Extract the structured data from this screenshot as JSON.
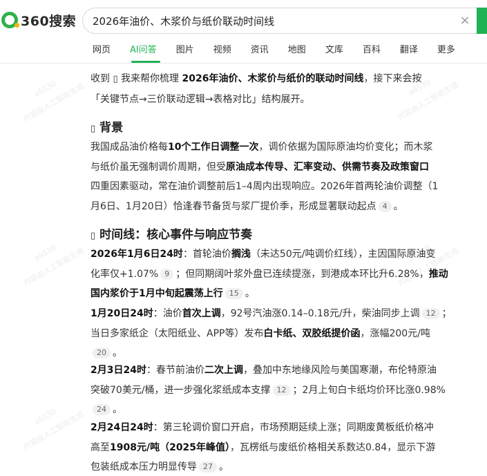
{
  "header": {
    "logo_text": "360搜索",
    "search_value": "2026年油价、木浆价与纸价联动时间线",
    "clear_symbol": "×"
  },
  "tabs": [
    "网页",
    "AI问答",
    "图片",
    "视频",
    "资讯",
    "地图",
    "文库",
    "百科",
    "翻译",
    "更多"
  ],
  "active_tab": "AI问答",
  "answer": {
    "intro_line1_a": "收到 ",
    "intro_icon": "▯",
    "intro_line1_b": " 我来帮你梳理 ",
    "intro_line1_bold": "2026年油价、木浆价与纸价的联动时间线",
    "intro_line1_c": "，接下来会按",
    "intro_line2": "「关键节点→三价联动逻辑→表格对比」结构展开。",
    "section1_icon": "▯",
    "section1_title": "背景",
    "bg_l1_a": "我国成品油价格每",
    "bg_l1_bold": "10个工作日调整一次",
    "bg_l1_b": "，调价依据为国际原油均价变化；而木浆",
    "bg_l2_a": "与纸价虽无强制调价周期，但受",
    "bg_l2_bold": "原油成本传导、汇率变动、供需节奏及政策窗口",
    "bg_l3": "四重因素驱动，常在油价调整前后1–4周内出现响应。2026年首两轮油价调整（1",
    "bg_l4": "月6日、1月20日）恰逢春节备货与浆厂提价季，形成显著联动起点",
    "bg_cite": "4",
    "bg_l4_end": "。",
    "section2_icon": "▯",
    "section2_title": "时间线：核心事件与响应节奏",
    "t1_l1_date": "2026年1月6日24时",
    "t1_l1_a": "：首轮油价",
    "t1_l1_bold": "搁浅",
    "t1_l1_b": "（未达50元/吨调价红线），主因国际原油变",
    "t1_l2_a": "化率仅+1.07%",
    "t1_cite1": "9",
    "t1_l2_b": "；但同期阔叶浆外盘已连续提涨，到港成本环比升6.28%，",
    "t1_l2_bold": "推动",
    "t1_l3_bold": "国内浆价于1月中旬起震荡上行",
    "t1_cite2": "15",
    "t1_end": "。",
    "t2_l1_date": "1月20日24时",
    "t2_l1_a": "：油价",
    "t2_l1_bold": "首次上调",
    "t2_l1_b": "，92号汽油涨0.14–0.18元/升，柴油同步上调",
    "t2_cite1": "12",
    "t2_l1_c": "；",
    "t2_l2_a": "当日多家纸企（太阳纸业、APP等）发布",
    "t2_l2_bold": "白卡纸、双胶纸提价函",
    "t2_l2_b": "，涨幅200元/吨",
    "t2_cite2": "20",
    "t2_end": "。",
    "t3_l1_date": "2月3日24时",
    "t3_l1_a": "：春节前油价",
    "t3_l1_bold": "二次上调",
    "t3_l1_b": "，叠加中东地缘风险与美国寒潮，布伦特原油",
    "t3_l2_a": "突破70美元/桶，进一步强化浆纸成本支撑",
    "t3_cite1": "12",
    "t3_l2_b": "；2月上旬白卡纸均价环比涨0.98%",
    "t3_cite2": "24",
    "t3_end": "。",
    "t4_l1_date": "2月24日24时",
    "t4_l1_a": "：第三轮调价窗口开启，市场预期延续上涨；同期废黄板纸价格冲",
    "t4_l2_a": "高至",
    "t4_l2_bold": "1908元/吨（2025年峰值）",
    "t4_l2_b": "，瓦楞纸与废纸价格相关系数达0.84，显示下游",
    "t4_l3": "包装纸成本压力明显传导",
    "t4_cite": "27",
    "t4_end": "。"
  },
  "watermark_text": "内容由人工智能生成",
  "watermark_id": "a6530"
}
